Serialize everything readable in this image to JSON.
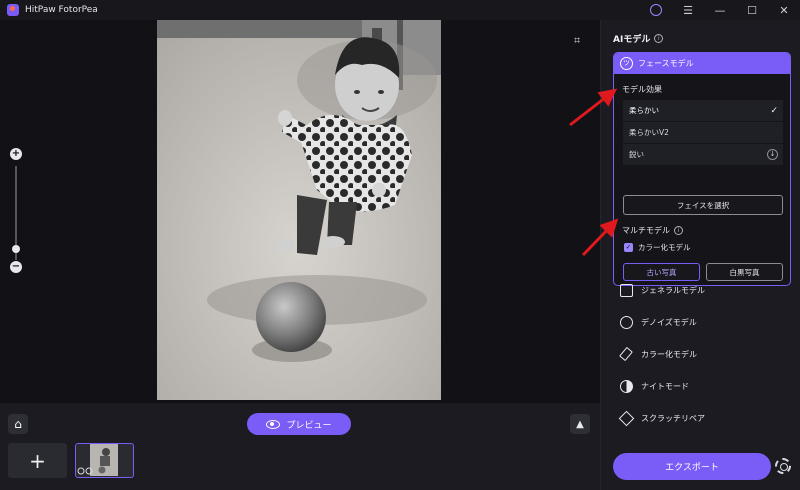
{
  "app": {
    "title": "HitPaw FotorPea"
  },
  "titlebar": {
    "menu_icon": "menu-icon",
    "minimize_glyph": "—",
    "maximize_glyph": "☐",
    "close_glyph": "✕"
  },
  "canvas": {
    "crop_icon_glyph": "⌗",
    "zoom_in_glyph": "+",
    "zoom_out_glyph": "−",
    "zoom_level": 0.12
  },
  "bottombar": {
    "home_glyph": "⌂",
    "preview_label": "プレビュー",
    "collapse_glyph": "▲",
    "add_glyph": "+"
  },
  "panel": {
    "title": "AIモデル",
    "face_model": {
      "label": "フェースモデル",
      "effect_label": "モデル効果",
      "options": [
        {
          "label": "柔らかい",
          "selected": true
        },
        {
          "label": "柔らかいV2",
          "selected": false
        },
        {
          "label": "鋭い",
          "selected": false,
          "download": true
        }
      ],
      "select_face_button": "フェイスを選択",
      "multi_model_label": "マルチモデル",
      "colorize_checkbox": "カラー化モデル",
      "colorize_checked": true,
      "modes": [
        "古い写真",
        "白黒写真"
      ],
      "active_mode": "古い写真"
    },
    "models": [
      {
        "label": "ジェネラルモデル",
        "icon": "image-icon"
      },
      {
        "label": "デノイズモデル",
        "icon": "denoise-icon"
      },
      {
        "label": "カラー化モデル",
        "icon": "brush-icon"
      },
      {
        "label": "ナイトモード",
        "icon": "night-icon"
      },
      {
        "label": "スクラッチリペア",
        "icon": "scratch-icon"
      }
    ],
    "export_label": "エクスポート"
  },
  "colors": {
    "accent": "#7a5cf6",
    "panel_bg": "#1b1b21",
    "canvas_bg": "#111116",
    "arrow": "#e0191f"
  }
}
